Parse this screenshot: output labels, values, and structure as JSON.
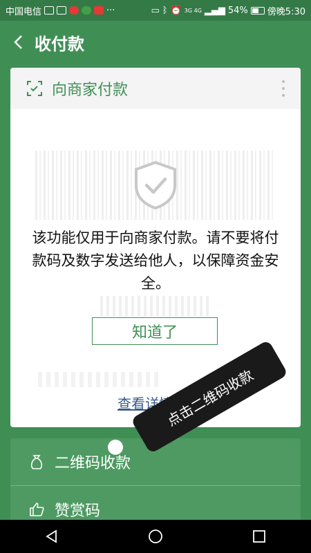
{
  "status_bar": {
    "carrier": "中国电信",
    "battery": "54%",
    "time": "傍晚5:30",
    "network": "3G 4G"
  },
  "header": {
    "title": "收付款"
  },
  "card": {
    "title": "向商家付款",
    "warning_text": "该功能仅用于向商家付款。请不要将付款码及数字发送给他人，以保障资金安全。",
    "ok_label": "知道了",
    "details_link": "查看详情"
  },
  "menu": {
    "items": [
      {
        "label": "二维码收款",
        "icon": "moneybag-icon"
      },
      {
        "label": "赞赏码",
        "icon": "thumbs-up-icon"
      }
    ]
  },
  "tooltip": {
    "text": "点击二维码收款"
  },
  "colors": {
    "primary_green": "#3f8f55",
    "dark_green": "#347a47",
    "card_bg": "#ffffff"
  }
}
